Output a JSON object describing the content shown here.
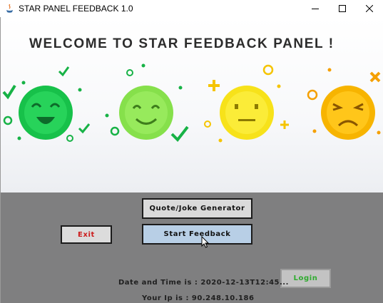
{
  "window": {
    "title": "STAR PANEL FEEDBACK 1.0",
    "controls": [
      "minimize",
      "maximize",
      "close"
    ]
  },
  "hero": {
    "heading": "WELCOME TO STAR FEEDBACK PANEL !",
    "faces": [
      {
        "mood": "very-happy",
        "color": "#17c14a"
      },
      {
        "mood": "happy",
        "color": "#86e04b"
      },
      {
        "mood": "neutral",
        "color": "#f7e21a"
      },
      {
        "mood": "sad",
        "color": "#f7b400"
      }
    ]
  },
  "buttons": {
    "quote": "Quote/Joke Generator",
    "feedback": "Start Feedback",
    "exit": "Exit",
    "login": "Login"
  },
  "info": {
    "datetime": "Date and Time is : 2020-12-13T12:45...",
    "ip": "Your Ip is : 90.248.10.186"
  },
  "colors": {
    "panel_bg": "#7f7f80",
    "exit_text": "#cc1c1c",
    "login_text": "#2eab2e",
    "feedback_bg": "#b8cfe6"
  }
}
